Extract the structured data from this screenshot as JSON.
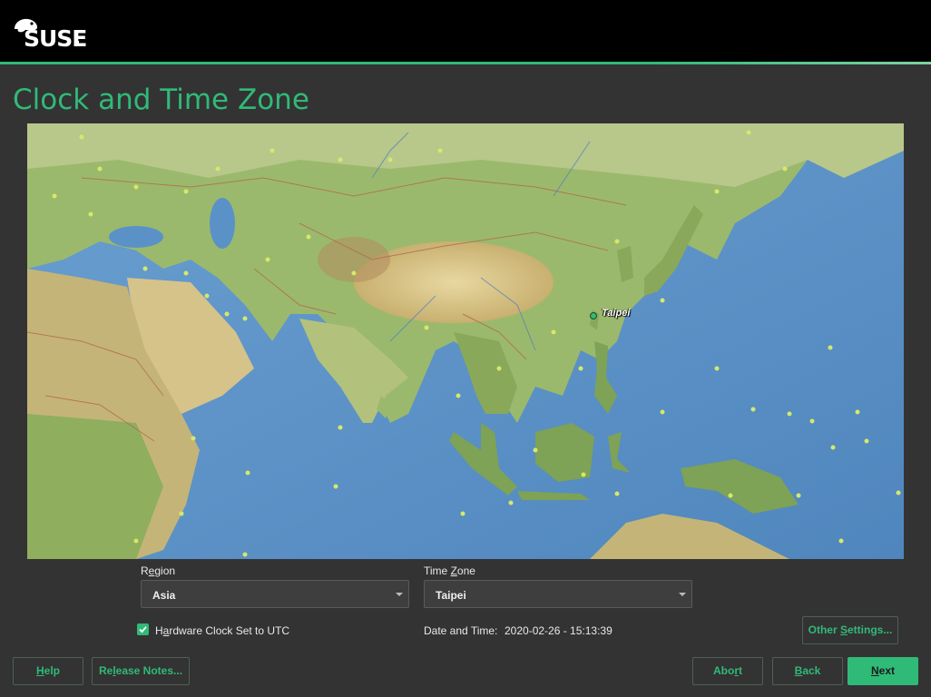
{
  "header": {
    "logo_text": "SUSE",
    "logo_icon": "chameleon-icon"
  },
  "page": {
    "title": "Clock and Time Zone"
  },
  "map": {
    "selected_city": "Taipei"
  },
  "region": {
    "label_pre": "R",
    "label_mnemonic": "e",
    "label_post": "gion",
    "value": "Asia"
  },
  "timezone": {
    "label_pre": "Time ",
    "label_mnemonic": "Z",
    "label_post": "one",
    "value": "Taipei"
  },
  "hwclock": {
    "label_pre": "H",
    "label_mnemonic": "a",
    "label_post": "rdware Clock Set to UTC",
    "checked": true
  },
  "datetime": {
    "label": "Date and Time:",
    "value": "2020-02-26 - 15:13:39"
  },
  "buttons": {
    "other_settings": {
      "pre": "Other ",
      "mnemonic": "S",
      "post": "ettings..."
    },
    "help": {
      "pre": "",
      "mnemonic": "H",
      "post": "elp"
    },
    "release_notes": {
      "pre": "Re",
      "mnemonic": "l",
      "post": "ease Notes..."
    },
    "abort": {
      "pre": "Abo",
      "mnemonic": "r",
      "post": "t"
    },
    "back": {
      "pre": "",
      "mnemonic": "B",
      "post": "ack"
    },
    "next": {
      "pre": "",
      "mnemonic": "N",
      "post": "ext"
    }
  },
  "colors": {
    "accent": "#30ba78",
    "background": "#333333",
    "topbar": "#000000"
  }
}
